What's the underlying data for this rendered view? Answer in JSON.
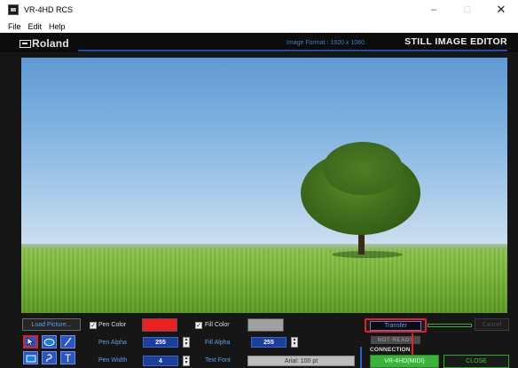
{
  "window": {
    "title": "VR-4HD RCS",
    "minimize_glyph": "–",
    "maximize_glyph": "□",
    "close_glyph": "✕"
  },
  "menu": [
    "File",
    "Edit",
    "Help"
  ],
  "header": {
    "brand": "Roland",
    "image_format": "Image Format : 1920 x 1080",
    "editor_title": "STILL IMAGE EDITOR"
  },
  "image": {
    "description_icon": "landscape-image"
  },
  "tools": {
    "load_picture": "Load Picture...",
    "text_tool_glyph": "T"
  },
  "pen": {
    "color_label": "Pen Color",
    "color_checked": true,
    "color_value": "#ee2020",
    "alpha_label": "Pen Alpha",
    "alpha_value": "255",
    "width_label": "Pen Width",
    "width_value": "4"
  },
  "fill": {
    "color_label": "Fill Color",
    "color_checked": true,
    "color_value": "#a0a0a0",
    "alpha_label": "Fill Alpha",
    "alpha_value": "255",
    "font_label": "Text Font",
    "font_value": "Arial: 100 pt"
  },
  "transfer": {
    "button_label": "Transfer",
    "cancel_label": "Cancel",
    "status": "NOT READY"
  },
  "connection": {
    "label": "CONNECTION",
    "device_button": "VR-4HD(MIDI)",
    "close_button": "CLOSE"
  },
  "colors": {
    "accent_blue": "#2a55c8",
    "highlight_red": "#e0202a",
    "connected_green": "#38b538"
  }
}
